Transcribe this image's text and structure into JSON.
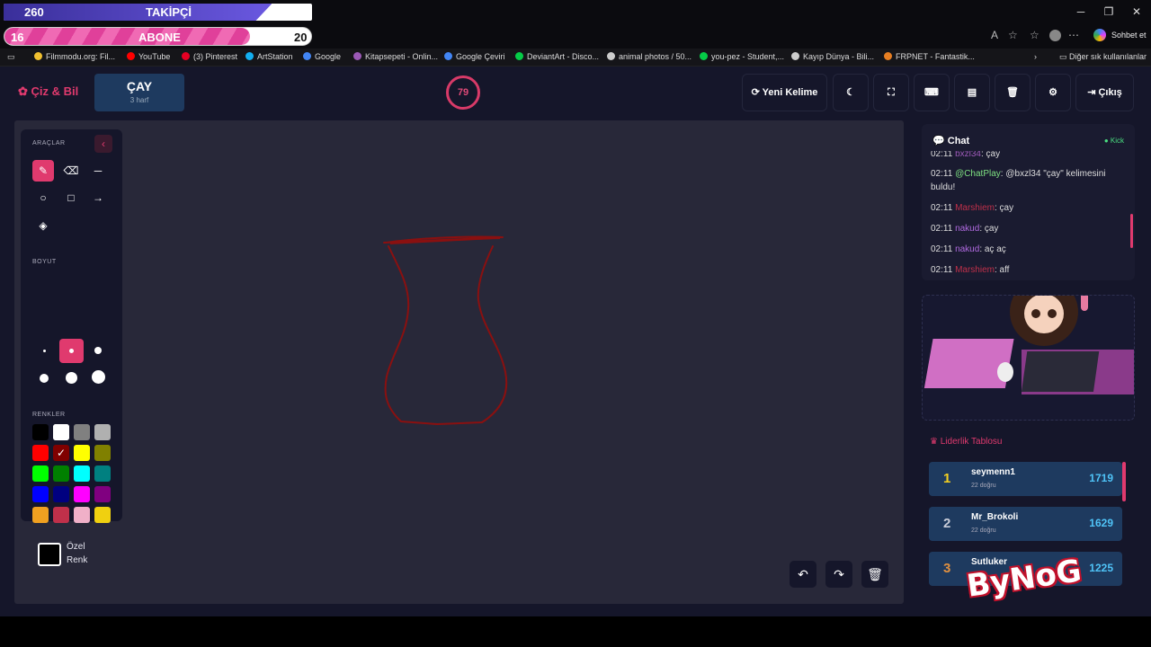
{
  "overlay": {
    "followers": {
      "current": "260",
      "label": "TAKİPÇİ",
      "goal": "300",
      "progress": 0.87
    },
    "subscribers": {
      "current": "16",
      "label": "ABONE",
      "goal": "20",
      "progress": 0.8
    }
  },
  "browser": {
    "chat_label": "Sohbet et",
    "bookmarks_more": "Diğer sık kullanılanlar"
  },
  "bookmarks": [
    {
      "label": "Filmmodu.org: Fil...",
      "color": "#f0c030"
    },
    {
      "label": "YouTube",
      "color": "#ff0000"
    },
    {
      "label": "(3) Pinterest",
      "color": "#e60023"
    },
    {
      "label": "ArtStation",
      "color": "#13aff0"
    },
    {
      "label": "Google",
      "color": "#4285f4"
    },
    {
      "label": "Kitapsepeti - Onlin...",
      "color": "#9b59b6"
    },
    {
      "label": "Google Çeviri",
      "color": "#4285f4"
    },
    {
      "label": "DeviantArt - Disco...",
      "color": "#05cc47"
    },
    {
      "label": "animal photos / 50...",
      "color": "#cccccc"
    },
    {
      "label": "you-pez - Student,...",
      "color": "#05cc47"
    },
    {
      "label": "Kayıp Dünya - Bili...",
      "color": "#cccccc"
    },
    {
      "label": "FRPNET - Fantastik...",
      "color": "#e67e22"
    }
  ],
  "app": {
    "logo": "Çiz & Bil",
    "word": "ÇAY",
    "word_hint": "3 harf",
    "timer": "79",
    "new_word_label": "Yeni Kelime",
    "exit_label": "Çıkış"
  },
  "tools": {
    "title": "ARAÇLAR",
    "size_title": "BOYUT",
    "colors_title": "RENKLER",
    "custom_label_1": "Özel",
    "custom_label_2": "Renk"
  },
  "palette": [
    "#000000",
    "#ffffff",
    "#808080",
    "#b0b0b0",
    "#ff0000",
    "#800000",
    "#ffff00",
    "#808000",
    "#00ff00",
    "#008000",
    "#00ffff",
    "#008080",
    "#0000ff",
    "#000080",
    "#ff00ff",
    "#800080",
    "#f0a020",
    "#c0304a",
    "#f0b0c8",
    "#f0d010"
  ],
  "chat": {
    "title": "Chat",
    "platform": "Kick",
    "messages": [
      {
        "time": "02:11",
        "user": "bxzl34",
        "user_color": "#9b59b6",
        "text": "çay"
      },
      {
        "time": "02:11",
        "user": "@ChatPlay",
        "user_color": "#7ee081",
        "text": "@bxzl34 \"çay\" kelimesini buldu!"
      },
      {
        "time": "02:11",
        "user": "Marshiem",
        "user_color": "#c0304a",
        "text": "çay"
      },
      {
        "time": "02:11",
        "user": "nakud",
        "user_color": "#b06ae0",
        "text": "çay"
      },
      {
        "time": "02:11",
        "user": "nakud",
        "user_color": "#b06ae0",
        "text": "aç aç"
      },
      {
        "time": "02:11",
        "user": "Marshiem",
        "user_color": "#c0304a",
        "text": "aff"
      }
    ]
  },
  "leaderboard": {
    "title": "Liderlik Tablosu",
    "rows": [
      {
        "rank": "1",
        "name": "seymenn1",
        "correct": "22 doğru",
        "score": "1719",
        "rank_color": "#f5d020"
      },
      {
        "rank": "2",
        "name": "Mr_Brokoli",
        "correct": "22 doğru",
        "score": "1629",
        "rank_color": "#c8ccd8"
      },
      {
        "rank": "3",
        "name": "Sutluker",
        "correct": "",
        "score": "1225",
        "rank_color": "#e09040"
      }
    ]
  },
  "watermark": "ByNoG"
}
